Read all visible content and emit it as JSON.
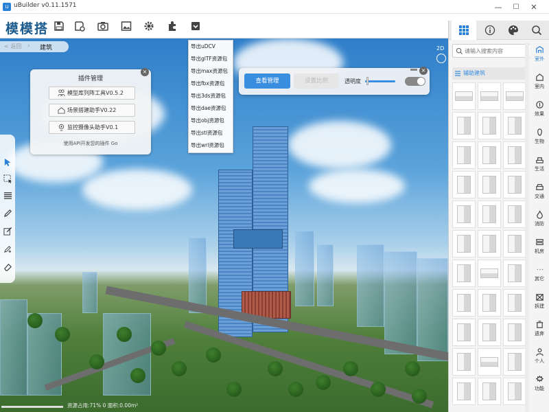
{
  "app": {
    "title": "uBuilder v0.11.1571",
    "logo": "模模搭"
  },
  "window": {
    "minimize": "—",
    "maximize": "☐",
    "close": "✕"
  },
  "toolbar": {
    "icons": [
      "save-icon",
      "save-as-icon",
      "camera-icon",
      "image-icon",
      "gear-icon",
      "plugin-icon",
      "export-icon"
    ]
  },
  "breadcrumb": {
    "back": "< 返回",
    "current": "建筑"
  },
  "plugin_panel": {
    "title": "插件管理",
    "items": [
      "模型库列阵工具V0.5.2",
      "场景搭建助手V0.22",
      "监控摄像头助手V0.1"
    ],
    "footer": "使用API开发您的插件 Go"
  },
  "export_menu": {
    "items": [
      "导出uDCV",
      "导出glTF资源包",
      "导出max资源包",
      "导出fbx资源包",
      "导出3ds资源包",
      "导出dae资源包",
      "导出obj资源包",
      "导出stl资源包",
      "导出wrl资源包"
    ]
  },
  "view_panel": {
    "view_manage": "查看管理",
    "set_ratio": "设置比例",
    "opacity_label": "透明度",
    "opacity": 0.05
  },
  "viewport": {
    "mode": "2D"
  },
  "status": {
    "text": "资源占用:71%  0   面积:0.00m²"
  },
  "right_panel": {
    "search_placeholder": "请输入搜索内容",
    "category_title": "辅助建筑",
    "thumb_count": 33
  },
  "categories": [
    {
      "label": "室外",
      "icon": "outdoor-icon",
      "active": true
    },
    {
      "label": "室内",
      "icon": "indoor-icon",
      "active": false
    },
    {
      "label": "效果",
      "icon": "effect-icon",
      "active": false
    },
    {
      "label": "生物",
      "icon": "creature-icon",
      "active": false
    },
    {
      "label": "生活",
      "icon": "life-icon",
      "active": false
    },
    {
      "label": "交通",
      "icon": "traffic-icon",
      "active": false
    },
    {
      "label": "消防",
      "icon": "fire-icon",
      "active": false
    },
    {
      "label": "机房",
      "icon": "server-room-icon",
      "active": false
    },
    {
      "label": "其它",
      "icon": "other-icon",
      "active": false
    },
    {
      "label": "拆建",
      "icon": "demolish-icon",
      "active": false
    },
    {
      "label": "遗弃",
      "icon": "trash-icon",
      "active": false
    },
    {
      "label": "个人",
      "icon": "user-icon",
      "active": false
    },
    {
      "label": "功能",
      "icon": "function-icon",
      "active": false
    }
  ],
  "colors": {
    "accent": "#3a8ee0",
    "logo": "#1c5b8e"
  }
}
